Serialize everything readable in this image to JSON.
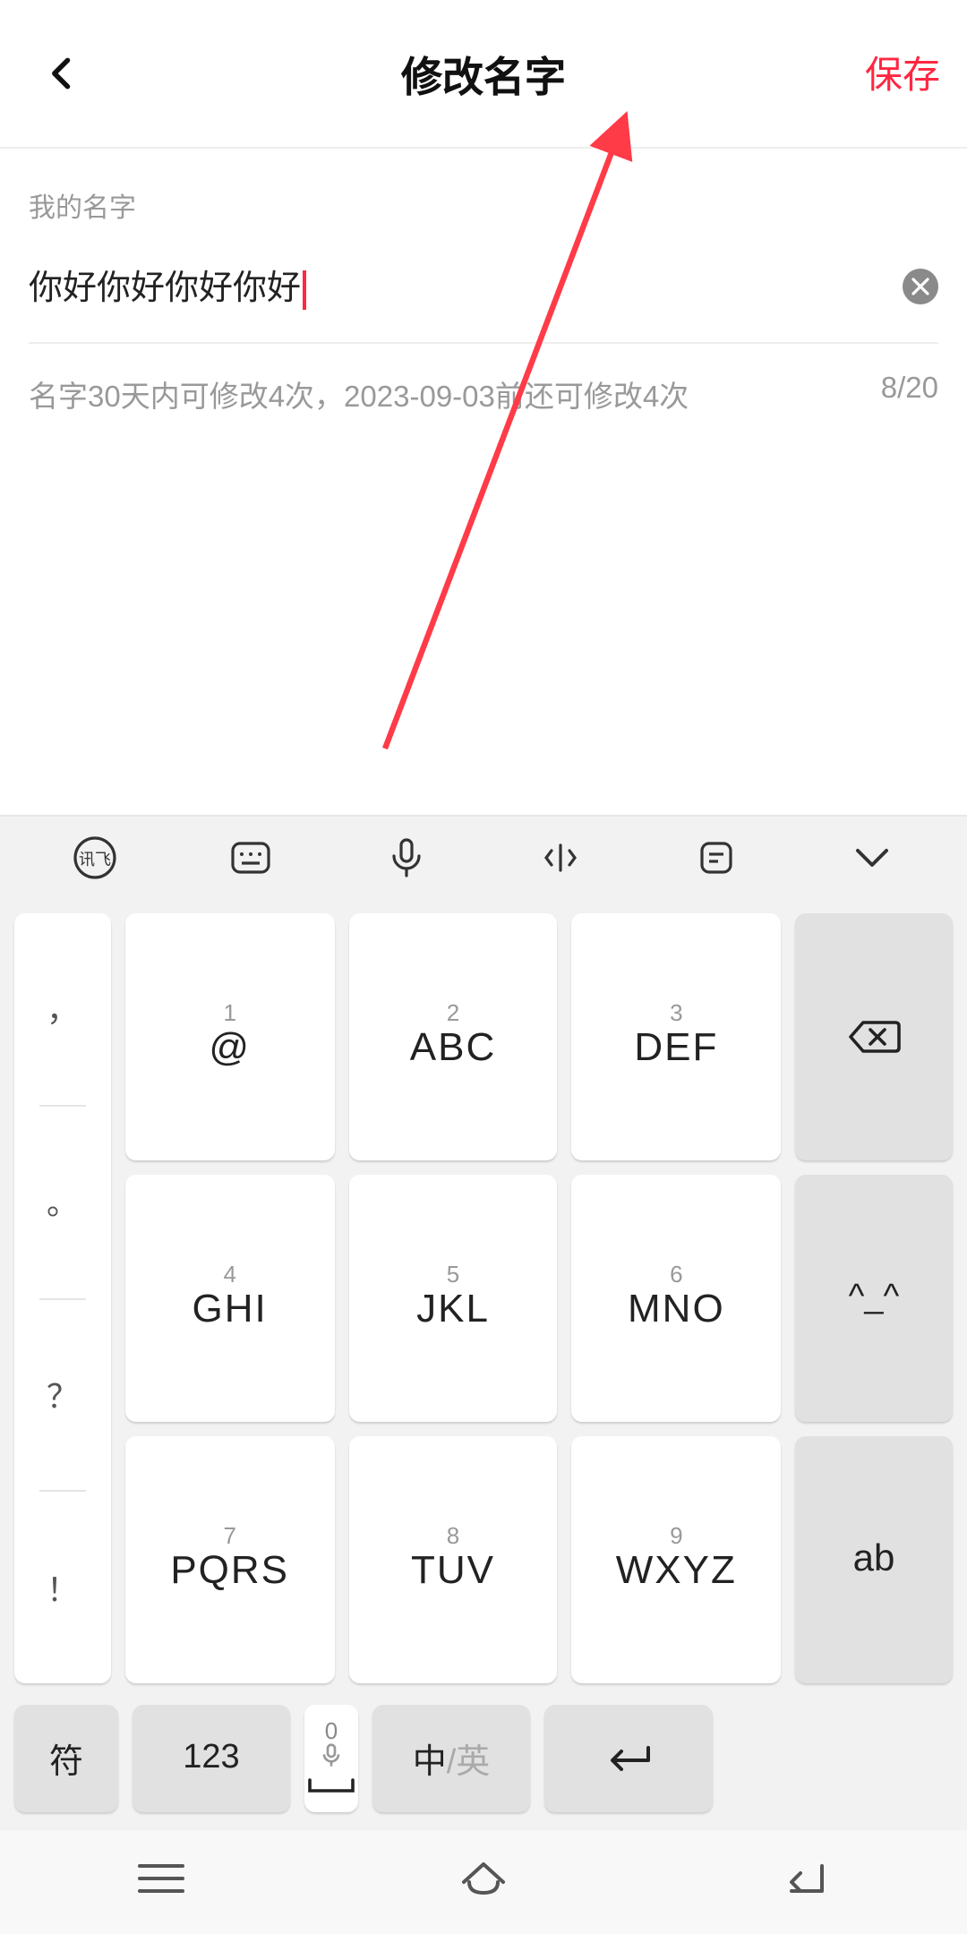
{
  "header": {
    "title": "修改名字",
    "save": "保存"
  },
  "form": {
    "label": "我的名字",
    "value": "你好你好你好你好",
    "hint": "名字30天内可修改4次，2023-09-03前还可修改4次",
    "counter": "8/20"
  },
  "keyboard": {
    "punct": [
      "，",
      "。",
      "？",
      "！"
    ],
    "rows": [
      [
        {
          "n": "1",
          "m": "@"
        },
        {
          "n": "2",
          "m": "ABC"
        },
        {
          "n": "3",
          "m": "DEF"
        }
      ],
      [
        {
          "n": "4",
          "m": "GHI"
        },
        {
          "n": "5",
          "m": "JKL"
        },
        {
          "n": "6",
          "m": "MNO"
        }
      ],
      [
        {
          "n": "7",
          "m": "PQRS"
        },
        {
          "n": "8",
          "m": "TUV"
        },
        {
          "n": "9",
          "m": "WXYZ"
        }
      ]
    ],
    "side": {
      "emoji": "^_^",
      "mode": "ab"
    },
    "bottom": {
      "sym": "符",
      "num": "123",
      "space_num": "0",
      "lang_main": "中",
      "lang_sec": "/英"
    }
  }
}
